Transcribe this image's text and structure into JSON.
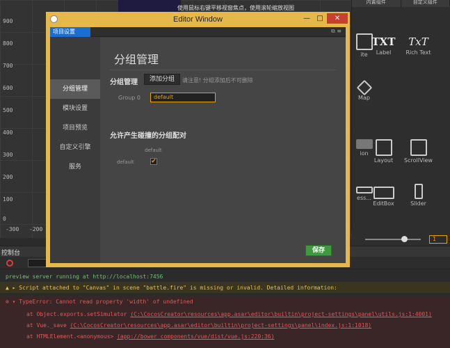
{
  "scene": {
    "top_hint": "使用鼠标右键平移视窗焦点，使用滚轮缩放视图",
    "y_labels": [
      "900",
      "800",
      "700",
      "600",
      "500",
      "400",
      "300",
      "200",
      "100",
      "0"
    ],
    "x_labels": [
      "-300",
      "-200"
    ]
  },
  "widgets": {
    "tab_left": "内置组件",
    "tab_right": "自定义组件",
    "items": [
      {
        "label": "ite",
        "icon": "sprite-icon"
      },
      {
        "label": "Label",
        "icon": "TXT"
      },
      {
        "label": "Rich Text",
        "icon": "TxT"
      },
      {
        "label": "Map",
        "icon": "tiledmap-icon"
      },
      {
        "label": "ion",
        "icon": "button-icon"
      },
      {
        "label": "Layout",
        "icon": "layout-icon"
      },
      {
        "label": "ScrollView",
        "icon": "scrollview-icon"
      },
      {
        "label": "ess...",
        "icon": "progressbar-icon"
      },
      {
        "label": "EditBox",
        "icon": "editbox-icon"
      },
      {
        "label": "Slider",
        "icon": "slider-icon"
      }
    ],
    "zoom_value": "1"
  },
  "console": {
    "tab_label": "控制台",
    "lines": {
      "server": "preview server running at http://localhost:7456",
      "warning": "Script attached to \"Canvas\" in scene \"battle.fire\" is missing or invalid. Detailed information:",
      "error": "TypeError: Cannot read property 'width' of undefined",
      "trace1_prefix": "at Object.exports.setSimulator",
      "trace1_link": "(C:\\CocosCreator\\resources\\app.asar\\editor\\builtin\\project-settings\\panel\\utils.js:1:4001)",
      "trace2_prefix": "at Vue._save",
      "trace2_link": "(C:\\CocosCreator\\resources\\app.asar\\editor\\builtin\\project-settings\\panel\\index.js:1:1018)",
      "trace3_prefix": "at HTMLElement.<anonymous>",
      "trace3_link": "(app://bower_components/vue/dist/vue.js:220:36)"
    }
  },
  "editor": {
    "window_title": "Editor Window",
    "close_glyph": "✕",
    "minimize_glyph": "—",
    "maximize_glyph": "□",
    "tab_label": "项目设置",
    "sidebar": [
      "分组管理",
      "模块设置",
      "项目预览",
      "自定义引擎",
      "服务"
    ],
    "heading": "分组管理",
    "group_label": "分组管理",
    "add_button": "添加分组",
    "hint": "请注意! 分组添加后不可删除",
    "group0_label": "Group 0",
    "group0_value": "default",
    "collide_label": "允许产生碰撞的分组配对",
    "col_header": "default",
    "row_header": "default",
    "collide_checked": "✔",
    "save_button": "保存"
  },
  "colors": {
    "accent": "#e8a300",
    "window_border": "#e6b84a",
    "tab_active": "#1b6ecf",
    "save": "#3f9a3f",
    "close": "#c7402f"
  }
}
